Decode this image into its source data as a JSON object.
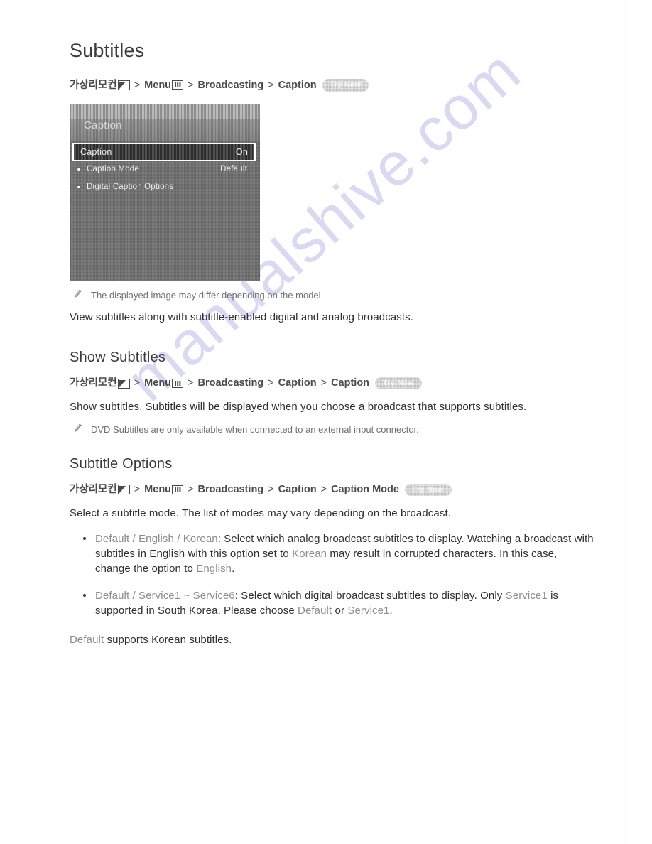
{
  "page": {
    "title": "Subtitles",
    "watermark": "manualshive.com"
  },
  "breadcrumbs": {
    "virtual_remote": "가상리모컨",
    "menu": "Menu",
    "separator": ">",
    "try_now": "Try Now",
    "subtitles": [
      "Broadcasting",
      "Caption"
    ],
    "show_subtitles": [
      "Broadcasting",
      "Caption",
      "Caption"
    ],
    "subtitle_options": [
      "Broadcasting",
      "Caption",
      "Caption Mode"
    ]
  },
  "tv_screenshot": {
    "header_title": "Caption",
    "highlight_row": {
      "label": "Caption",
      "value": "On"
    },
    "rows": [
      {
        "label": "Caption Mode",
        "value": "Default"
      },
      {
        "label": "Digital Caption Options",
        "value": ""
      }
    ]
  },
  "notes": {
    "image_differs": "The displayed image may differ depending on the model.",
    "dvd_subtitles": "DVD Subtitles are only available when connected to an external input connector."
  },
  "sections": {
    "subtitles": {
      "body": "View subtitles along with subtitle-enabled digital and analog broadcasts."
    },
    "show_subtitles": {
      "heading": "Show Subtitles",
      "body": "Show subtitles. Subtitles will be displayed when you choose a broadcast that supports subtitles."
    },
    "subtitle_options": {
      "heading": "Subtitle Options",
      "body": "Select a subtitle mode. The list of modes may vary depending on the broadcast.",
      "bullets": [
        {
          "kw1": "Default / English / Korean",
          "t1": ": Select which analog broadcast subtitles to display. Watching a broadcast with subtitles in English with this option set to ",
          "kw2": "Korean",
          "t2": " may result in corrupted characters. In this case, change the option to ",
          "kw3": "English",
          "t3": "."
        },
        {
          "kw1": "Default / Service1 ~ Service6",
          "t1": ": Select which digital broadcast subtitles to display. Only ",
          "kw2": "Service1",
          "t2": " is supported in South Korea. Please choose ",
          "kw3": "Default",
          "t3": " or ",
          "kw4": "Service1",
          "t4": "."
        }
      ],
      "footer_kw": "Default",
      "footer_text": " supports Korean subtitles."
    }
  },
  "colors": {
    "text": "#2f2f2f",
    "keyword": "#8c8c8c",
    "note": "#707070",
    "watermark": "#d9d9f2",
    "tv_body": "#6f6f6f",
    "try_now_bg": "#b9b9b9"
  }
}
